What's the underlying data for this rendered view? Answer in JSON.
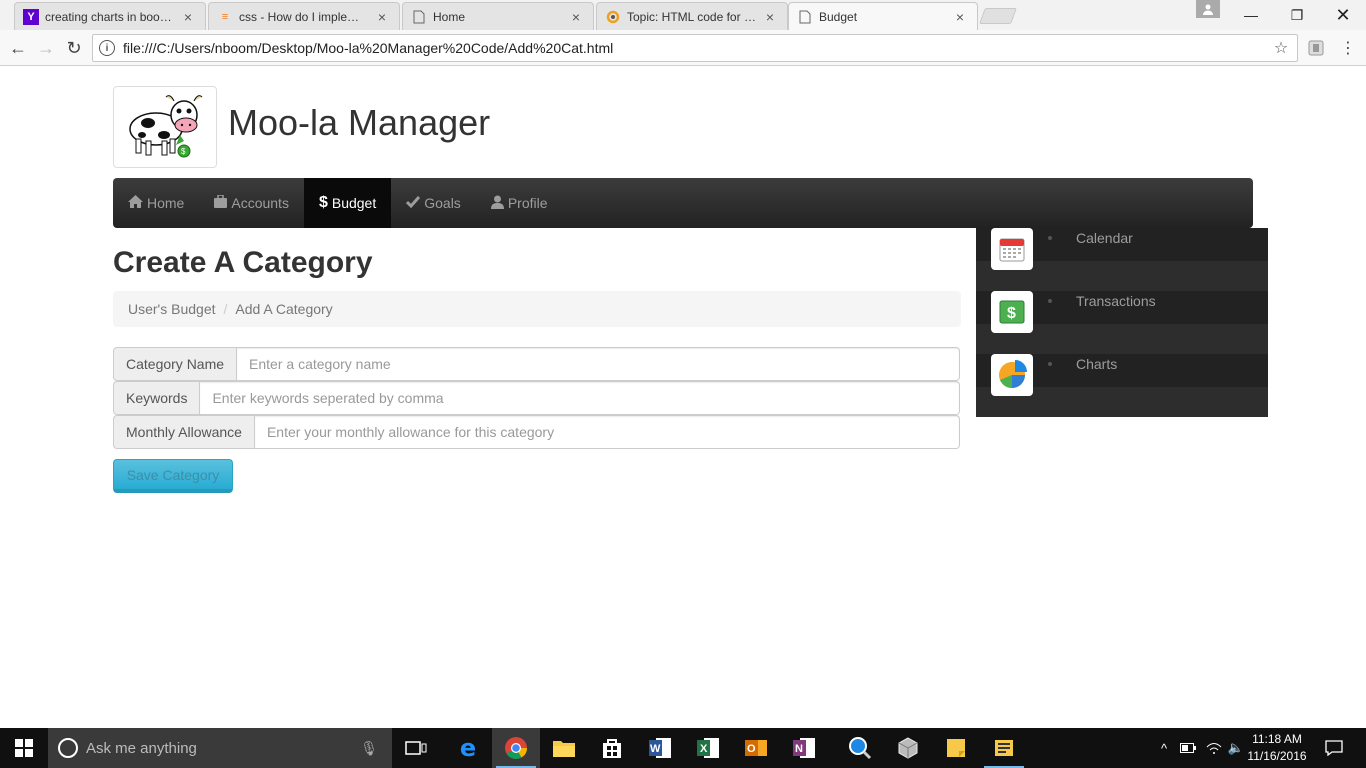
{
  "browser": {
    "tabs": [
      {
        "title": "creating charts in bootstra",
        "favicon": "yahoo-icon"
      },
      {
        "title": "css - How do I implement",
        "favicon": "stackoverflow-icon"
      },
      {
        "title": "Home",
        "favicon": "page-icon"
      },
      {
        "title": "Topic: HTML code for visi",
        "favicon": "loading-icon"
      },
      {
        "title": "Budget",
        "favicon": "page-icon",
        "active": true
      }
    ],
    "url": "file:///C:/Users/nboom/Desktop/Moo-la%20Manager%20Code/Add%20Cat.html"
  },
  "site": {
    "title": "Moo-la Manager"
  },
  "navbar": {
    "items": [
      {
        "label": "Home",
        "icon": "home-icon"
      },
      {
        "label": "Accounts",
        "icon": "briefcase-icon"
      },
      {
        "label": "Budget",
        "icon": "dollar-icon",
        "active": true
      },
      {
        "label": "Goals",
        "icon": "checkmark-icon"
      },
      {
        "label": "Profile",
        "icon": "user-icon"
      }
    ]
  },
  "page": {
    "title": "Create A Category",
    "breadcrumb": [
      "User's Budget",
      "Add A Category"
    ],
    "form": {
      "fields": [
        {
          "label": "Category Name",
          "placeholder": "Enter a category name",
          "value": ""
        },
        {
          "label": "Keywords",
          "placeholder": "Enter keywords seperated by comma",
          "value": ""
        },
        {
          "label": "Monthly Allowance",
          "placeholder": "Enter your monthly allowance for this category",
          "value": ""
        }
      ],
      "submit_label": "Save Category"
    }
  },
  "side_menu": {
    "items": [
      {
        "label": "Calendar",
        "icon": "calendar-icon"
      },
      {
        "label": "Transactions",
        "icon": "money-icon"
      },
      {
        "label": "Charts",
        "icon": "pie-chart-icon"
      }
    ]
  },
  "taskbar": {
    "search_placeholder": "Ask me anything",
    "time": "11:18 AM",
    "date": "11/16/2016"
  },
  "colors": {
    "navbar_bg": "#222222",
    "nav_active_bg": "#0a0a0a",
    "info_button": "#5bc0de",
    "taskbar_bg": "#101010"
  }
}
